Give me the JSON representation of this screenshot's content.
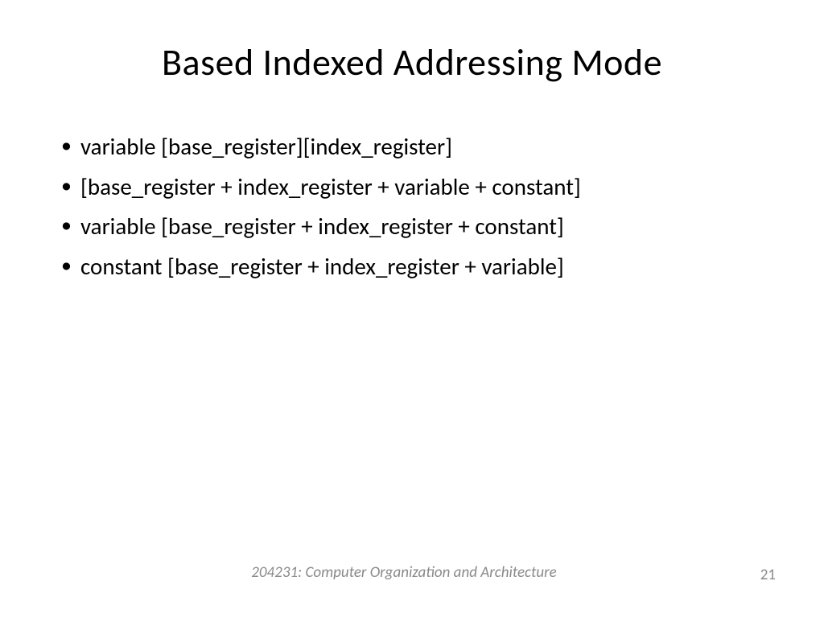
{
  "slide": {
    "title": "Based Indexed Addressing Mode",
    "bullets": [
      "variable [base_register][index_register]",
      "[base_register + index_register + variable + constant]",
      "variable [base_register + index_register + constant]",
      "constant [base_register + index_register + variable]"
    ],
    "footer": "204231: Computer Organization and Architecture",
    "page_number": "21"
  }
}
